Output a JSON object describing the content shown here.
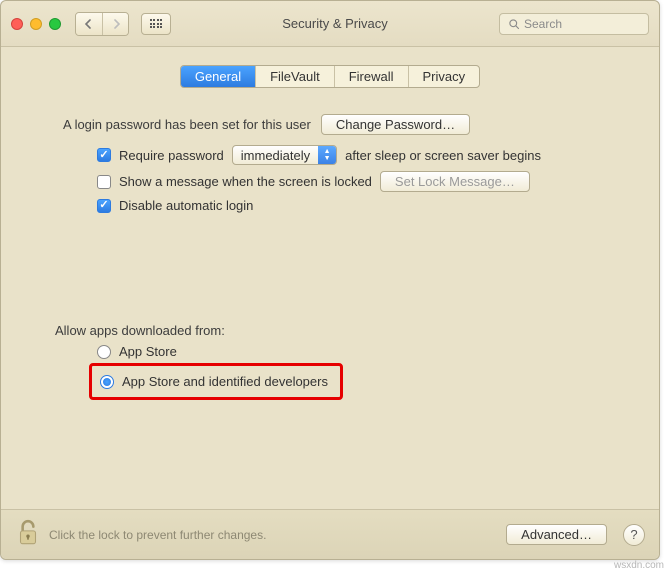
{
  "titlebar": {
    "title": "Security & Privacy",
    "search_placeholder": "Search"
  },
  "tabs": {
    "items": [
      {
        "label": "General",
        "active": true
      },
      {
        "label": "FileVault",
        "active": false
      },
      {
        "label": "Firewall",
        "active": false
      },
      {
        "label": "Privacy",
        "active": false
      }
    ]
  },
  "login_section": {
    "password_set_text": "A login password has been set for this user",
    "change_password_btn": "Change Password…",
    "require_password": {
      "label_before": "Require password",
      "dropdown_value": "immediately",
      "label_after": "after sleep or screen saver begins",
      "checked": true
    },
    "show_message": {
      "label": "Show a message when the screen is locked",
      "checked": false,
      "btn": "Set Lock Message…"
    },
    "disable_auto_login": {
      "label": "Disable automatic login",
      "checked": true
    }
  },
  "allow_apps": {
    "heading": "Allow apps downloaded from:",
    "options": [
      {
        "label": "App Store",
        "selected": false
      },
      {
        "label": "App Store and identified developers",
        "selected": true
      }
    ]
  },
  "footer": {
    "lock_text": "Click the lock to prevent further changes.",
    "advanced_btn": "Advanced…",
    "help": "?"
  },
  "watermark": "wsxdn.com"
}
